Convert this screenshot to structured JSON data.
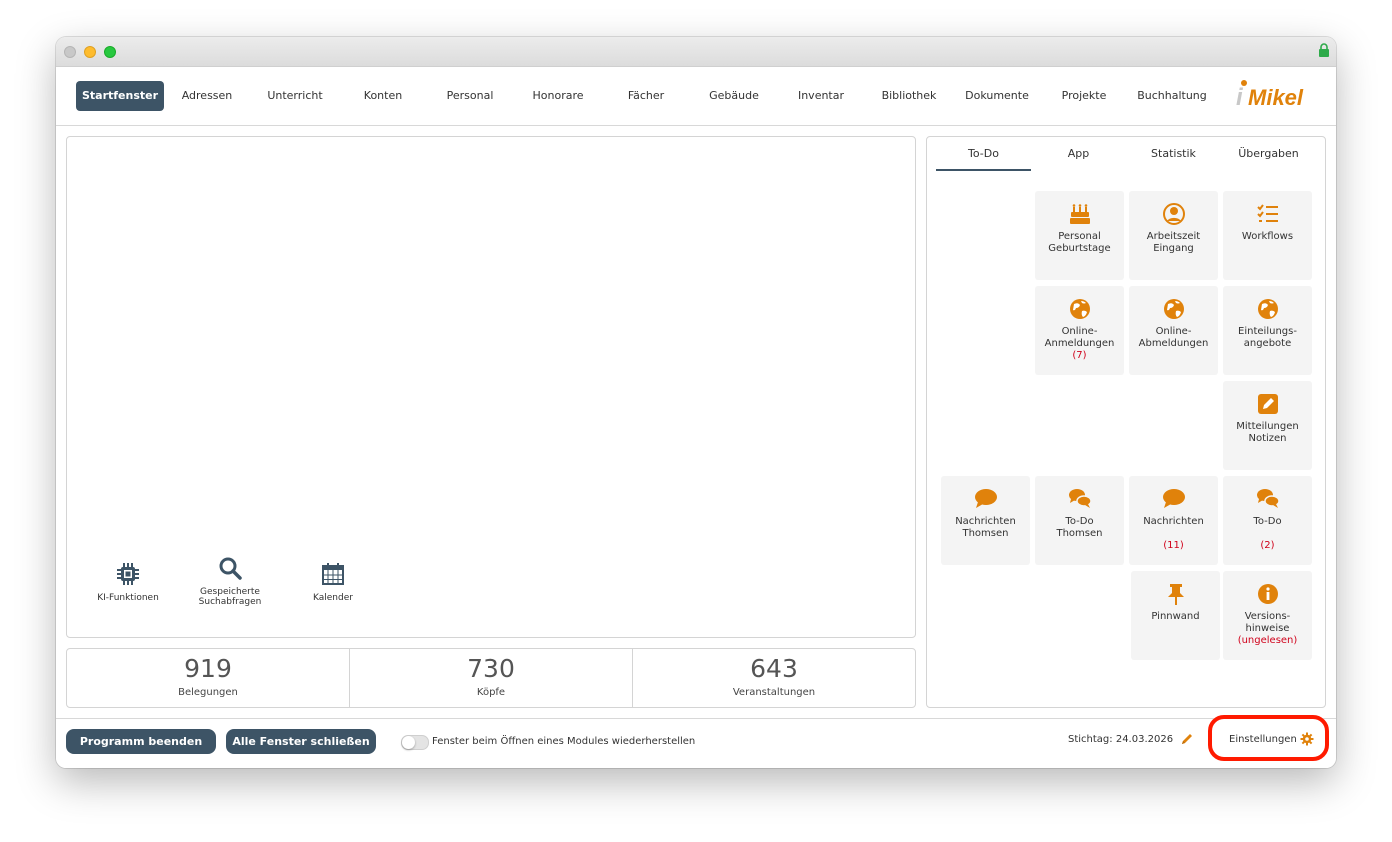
{
  "menu": {
    "items": [
      {
        "label": "Startfenster",
        "active": true
      },
      {
        "label": "Adressen"
      },
      {
        "label": "Unterricht"
      },
      {
        "label": "Konten"
      },
      {
        "label": "Personal"
      },
      {
        "label": "Honorare"
      },
      {
        "label": "Fächer"
      },
      {
        "label": "Gebäude"
      },
      {
        "label": "Inventar"
      },
      {
        "label": "Bibliothek"
      },
      {
        "label": "Dokumente"
      },
      {
        "label": "Projekte"
      },
      {
        "label": "Buchhaltung"
      }
    ],
    "logo_text": "iMikel"
  },
  "left": {
    "icons": [
      {
        "label": "KI-Funktionen",
        "icon": "chip-icon"
      },
      {
        "label_line1": "Gespeicherte",
        "label_line2": "Suchabfragen",
        "icon": "search-icon"
      },
      {
        "label": "Kalender",
        "icon": "calendar-icon"
      }
    ]
  },
  "stats": [
    {
      "value": "919",
      "label": "Belegungen"
    },
    {
      "value": "730",
      "label": "Köpfe"
    },
    {
      "value": "643",
      "label": "Veranstaltungen"
    }
  ],
  "right": {
    "tabs": [
      {
        "label": "To-Do",
        "active": true
      },
      {
        "label": "App"
      },
      {
        "label": "Statistik"
      },
      {
        "label": "Übergaben"
      }
    ],
    "tiles": {
      "personal_geburtstage": {
        "line1": "Personal",
        "line2": "Geburtstage",
        "icon": "birthday-cake-icon"
      },
      "arbeitszeit_eingang": {
        "line1": "Arbeitszeit",
        "line2": "Eingang",
        "icon": "user-icon"
      },
      "workflows": {
        "line1": "Workflows",
        "icon": "checklist-icon"
      },
      "online_anmeldungen": {
        "line1": "Online-",
        "line2": "Anmeldungen",
        "count": "(7)",
        "icon": "globe-icon"
      },
      "online_abmeldungen": {
        "line1": "Online-",
        "line2": "Abmeldungen",
        "icon": "globe-icon"
      },
      "einteilungsangebote": {
        "line1": "Einteilungs-",
        "line2": "angebote",
        "icon": "globe-icon"
      },
      "mitteilungen_notizen": {
        "line1": "Mitteilungen",
        "line2": "Notizen",
        "icon": "edit-icon"
      },
      "nachrichten_thomsen": {
        "line1": "Nachrichten",
        "line2": "Thomsen",
        "icon": "chat-bubble-icon"
      },
      "todo_thomsen": {
        "line1": "To-Do",
        "line2": "Thomsen",
        "icon": "chat-bubbles-icon"
      },
      "nachrichten": {
        "line1": "Nachrichten",
        "count": "(11)",
        "icon": "chat-bubble-icon"
      },
      "todo": {
        "line1": "To-Do",
        "count": "(2)",
        "icon": "chat-bubbles-icon"
      },
      "pinnwand": {
        "line1": "Pinnwand",
        "icon": "pushpin-icon"
      },
      "versionshinweise": {
        "line1": "Versions-",
        "line2": "hinweise",
        "count": "(ungelesen)",
        "icon": "info-icon"
      }
    }
  },
  "footer": {
    "quit_label": "Programm beenden",
    "close_all_label": "Alle Fenster schließen",
    "toggle_label": "Fenster beim Öffnen eines Modules wiederherstellen",
    "stichtag": "Stichtag: 24.03.2026",
    "settings_label": "Einstellungen"
  },
  "colors": {
    "accent": "#3d5466",
    "icon_orange": "#e0820b",
    "alert_red": "#d0021b",
    "highlight": "#ff1a00"
  }
}
